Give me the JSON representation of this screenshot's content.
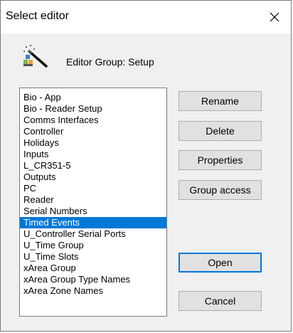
{
  "dialog": {
    "title": "Select editor",
    "close_glyph": "✕",
    "group_label": "Editor Group: Setup",
    "icon": "magic-wand-icon"
  },
  "list": {
    "items": [
      "Bio - App",
      "Bio - Reader Setup",
      "Comms Interfaces",
      "Controller",
      "Holidays",
      "Inputs",
      "L_CR351-5",
      "Outputs",
      "PC",
      "Reader",
      "Serial Numbers",
      "Timed Events",
      "U_Controller Serial Ports",
      "U_Time Group",
      "U_Time Slots",
      "xArea Group",
      "xArea Group Type Names",
      "xArea Zone Names"
    ],
    "selected": "Timed Events"
  },
  "buttons": {
    "rename": "Rename",
    "delete": "Delete",
    "properties": "Properties",
    "group_access": "Group access",
    "open": "Open",
    "cancel": "Cancel"
  },
  "colors": {
    "selection": "#0078d7",
    "button_face": "#e1e1e1",
    "dialog_bg": "#f0f0f0"
  }
}
